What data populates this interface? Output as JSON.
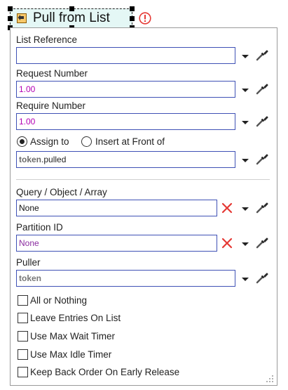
{
  "header": {
    "title": "Pull from List"
  },
  "fields": {
    "list_reference": {
      "label": "List Reference",
      "value": ""
    },
    "request_number": {
      "label": "Request Number",
      "value": "1.00"
    },
    "require_number": {
      "label": "Require Number",
      "value": "1.00"
    },
    "assign_to": {
      "label": "Assign to",
      "checked": true
    },
    "insert_front": {
      "label": "Insert at Front of",
      "checked": false
    },
    "target": {
      "token": "token",
      "rest": ".pulled"
    },
    "query": {
      "label": "Query / Object / Array",
      "value": "None"
    },
    "partition": {
      "label": "Partition ID",
      "value": "None"
    },
    "puller": {
      "label": "Puller",
      "value": "token"
    }
  },
  "checkboxes": [
    {
      "label": "All or Nothing",
      "checked": false
    },
    {
      "label": "Leave Entries On List",
      "checked": false
    },
    {
      "label": "Use Max Wait Timer",
      "checked": false
    },
    {
      "label": "Use Max Idle Timer",
      "checked": false
    },
    {
      "label": "Keep Back Order On Early Release",
      "checked": false
    }
  ],
  "colors": {
    "field_border": "#3f51b5",
    "number_value": "#b400b4",
    "clear_x": "#e53935",
    "title_bg": "#e4f7f5",
    "warning": "#e53935"
  },
  "icons": [
    "list-pull-icon",
    "warning-icon",
    "dropdown-arrow-icon",
    "eyedropper-icon",
    "clear-x-icon",
    "resize-grip-icon"
  ]
}
